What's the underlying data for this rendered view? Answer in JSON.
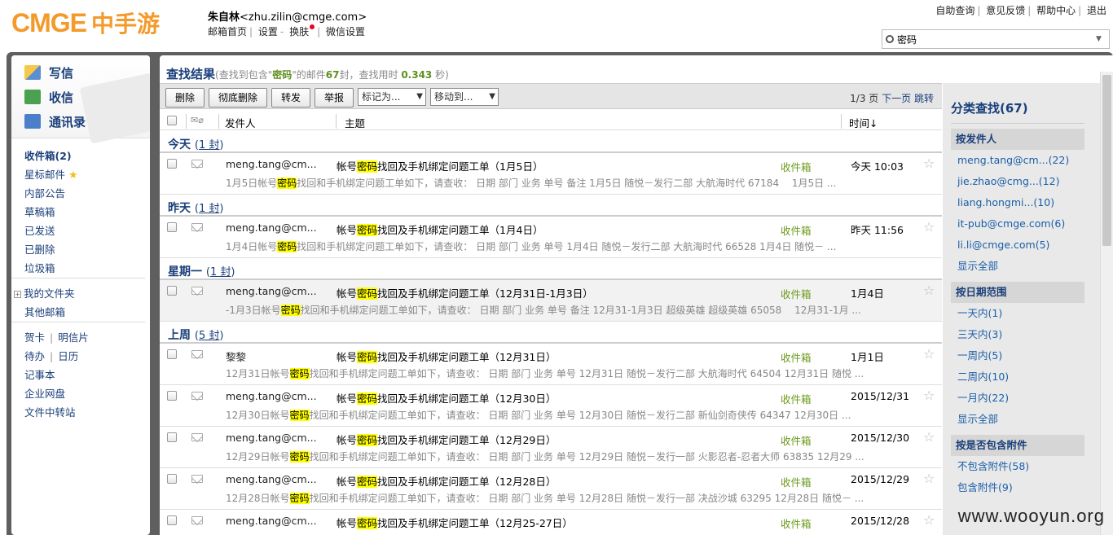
{
  "header": {
    "logo_en": "CMGE",
    "logo_cn": "中手游",
    "user_name": "朱自林",
    "user_email": "<zhu.zilin@cmge.com>",
    "links": [
      "邮箱首页",
      "设置",
      "换肤",
      "微信设置"
    ],
    "top_links": [
      "自助查询",
      "意见反馈",
      "帮助中心",
      "退出"
    ],
    "search_value": "密码"
  },
  "left": {
    "quick": [
      "写信",
      "收信",
      "通讯录"
    ],
    "folders": {
      "inbox": "收件箱(2)",
      "starred": "星标邮件",
      "notice": "内部公告",
      "drafts": "草稿箱",
      "sent": "已发送",
      "deleted": "已删除",
      "spam": "垃圾箱",
      "myfolders": "我的文件夹",
      "other": "其他邮箱",
      "card": "贺卡",
      "postcard": "明信片",
      "todo": "待办",
      "calendar": "日历",
      "notes": "记事本",
      "netdisk": "企业网盘",
      "transfer": "文件中转站"
    }
  },
  "result": {
    "title": "查找结果",
    "pre": "(查找到包含\"",
    "keyword": "密码",
    "mid": "\"的邮件",
    "count": "67",
    "mid2": "封，查找用时",
    "time": "0.343",
    "post": "秒)"
  },
  "toolbar": {
    "delete": "删除",
    "purge": "彻底删除",
    "forward": "转发",
    "report": "举报",
    "mark": "标记为...",
    "move": "移动到...",
    "page": "1/3 页",
    "next": "下一页",
    "jump": "跳转"
  },
  "columns": {
    "from": "发件人",
    "subject": "主题",
    "time": "时间↓"
  },
  "groups": [
    {
      "label": "今天",
      "count": "1 封"
    },
    {
      "label": "昨天",
      "count": "1 封"
    },
    {
      "label": "星期一",
      "count": "1 封"
    },
    {
      "label": "上周",
      "count": "5 封"
    }
  ],
  "emails": [
    {
      "from": "meng.tang@cm...",
      "subj_a": "帐号",
      "subj_b": "找回及手机绑定问题工单（1月5日）",
      "folder": "收件箱",
      "time": "今天 10:03",
      "sum_a": "1月5日帐号",
      "sum_b": "找回和手机绑定问题工单如下，请查收： 日期 部门 业务 单号 备注 1月5日 随悦－发行二部 大航海时代 67184 　1月5日 ..."
    },
    {
      "from": "meng.tang@cm...",
      "subj_a": "帐号",
      "subj_b": "找回及手机绑定问题工单（1月4日）",
      "folder": "收件箱",
      "time": "昨天 11:56",
      "sum_a": "1月4日帐号",
      "sum_b": "找回和手机绑定问题工单如下，请查收： 日期 部门 业务 单号 1月4日 随悦－发行二部 大航海时代 66528 1月4日 随悦－ ..."
    },
    {
      "from": "meng.tang@cm...",
      "subj_a": "帐号",
      "subj_b": "找回及手机绑定问题工单（12月31日-1月3日）",
      "folder": "收件箱",
      "time": "1月4日",
      "sum_a": "-1月3日帐号",
      "sum_b": "找回和手机绑定问题工单如下，请查收： 日期 部门 业务 单号 备注 12月31-1月3日 超级英雄 超级英雄 65058 　12月31-1月 ..."
    },
    {
      "from": "黎黎",
      "subj_a": "帐号",
      "subj_b": "找回及手机绑定问题工单（12月31日）",
      "folder": "收件箱",
      "time": "1月1日",
      "sum_a": "12月31日帐号",
      "sum_b": "找回和手机绑定问题工单如下，请查收： 日期 部门 业务 单号 12月31日 随悦－发行二部 大航海时代 64504 12月31日 随悦 ..."
    },
    {
      "from": "meng.tang@cm...",
      "subj_a": "帐号",
      "subj_b": "找回及手机绑定问题工单（12月30日）",
      "folder": "收件箱",
      "time": "2015/12/31",
      "sum_a": "12月30日帐号",
      "sum_b": "找回和手机绑定问题工单如下，请查收： 日期 部门 业务 单号 12月30日 随悦－发行二部 新仙剑奇侠传 64347 12月30日 ..."
    },
    {
      "from": "meng.tang@cm...",
      "subj_a": "帐号",
      "subj_b": "找回及手机绑定问题工单（12月29日）",
      "folder": "收件箱",
      "time": "2015/12/30",
      "sum_a": "12月29日帐号",
      "sum_b": "找回和手机绑定问题工单如下，请查收： 日期 部门 业务 单号 12月29日 随悦－发行一部 火影忍者-忍者大师 63835 12月29 ..."
    },
    {
      "from": "meng.tang@cm...",
      "subj_a": "帐号",
      "subj_b": "找回及手机绑定问题工单（12月28日）",
      "folder": "收件箱",
      "time": "2015/12/29",
      "sum_a": "12月28日帐号",
      "sum_b": "找回和手机绑定问题工单如下，请查收： 日期 部门 业务 单号 12月28日 随悦－发行一部 决战沙城 63295 12月28日 随悦－ ..."
    },
    {
      "from": "meng.tang@cm...",
      "subj_a": "帐号",
      "subj_b": "找回及手机绑定问题工单（12月25-27日）",
      "folder": "收件箱",
      "time": "2015/12/28",
      "sum_a": "",
      "sum_b": ""
    }
  ],
  "right": {
    "title": "分类查找(67)",
    "by_sender": "按发件人",
    "senders": [
      "meng.tang@cm...(22)",
      "jie.zhao@cmg...(12)",
      "liang.hongmi...(10)",
      "it-pub@cmge.com(6)",
      "li.li@cmge.com(5)",
      "显示全部"
    ],
    "by_date": "按日期范围",
    "dates": [
      "一天内(1)",
      "三天内(3)",
      "一周内(5)",
      "二周内(10)",
      "一月内(22)",
      "显示全部"
    ],
    "by_attach": "按是否包含附件",
    "attach": [
      "不包含附件(58)",
      "包含附件(9)"
    ]
  },
  "watermark": "www.wooyun.org"
}
